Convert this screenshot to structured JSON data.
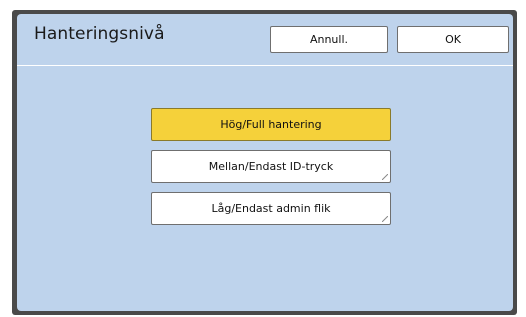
{
  "dialog": {
    "title": "Hanteringsnivå",
    "cancel_label": "Annull.",
    "ok_label": "OK"
  },
  "options": [
    {
      "label": "Hög/Full hantering",
      "selected": true
    },
    {
      "label": "Mellan/Endast ID-tryck",
      "selected": false
    },
    {
      "label": "Låg/Endast admin flik",
      "selected": false
    }
  ],
  "colors": {
    "panel_background": "#bed3ec",
    "selected_option": "#f5d13a",
    "frame": "#4a4a4a"
  }
}
